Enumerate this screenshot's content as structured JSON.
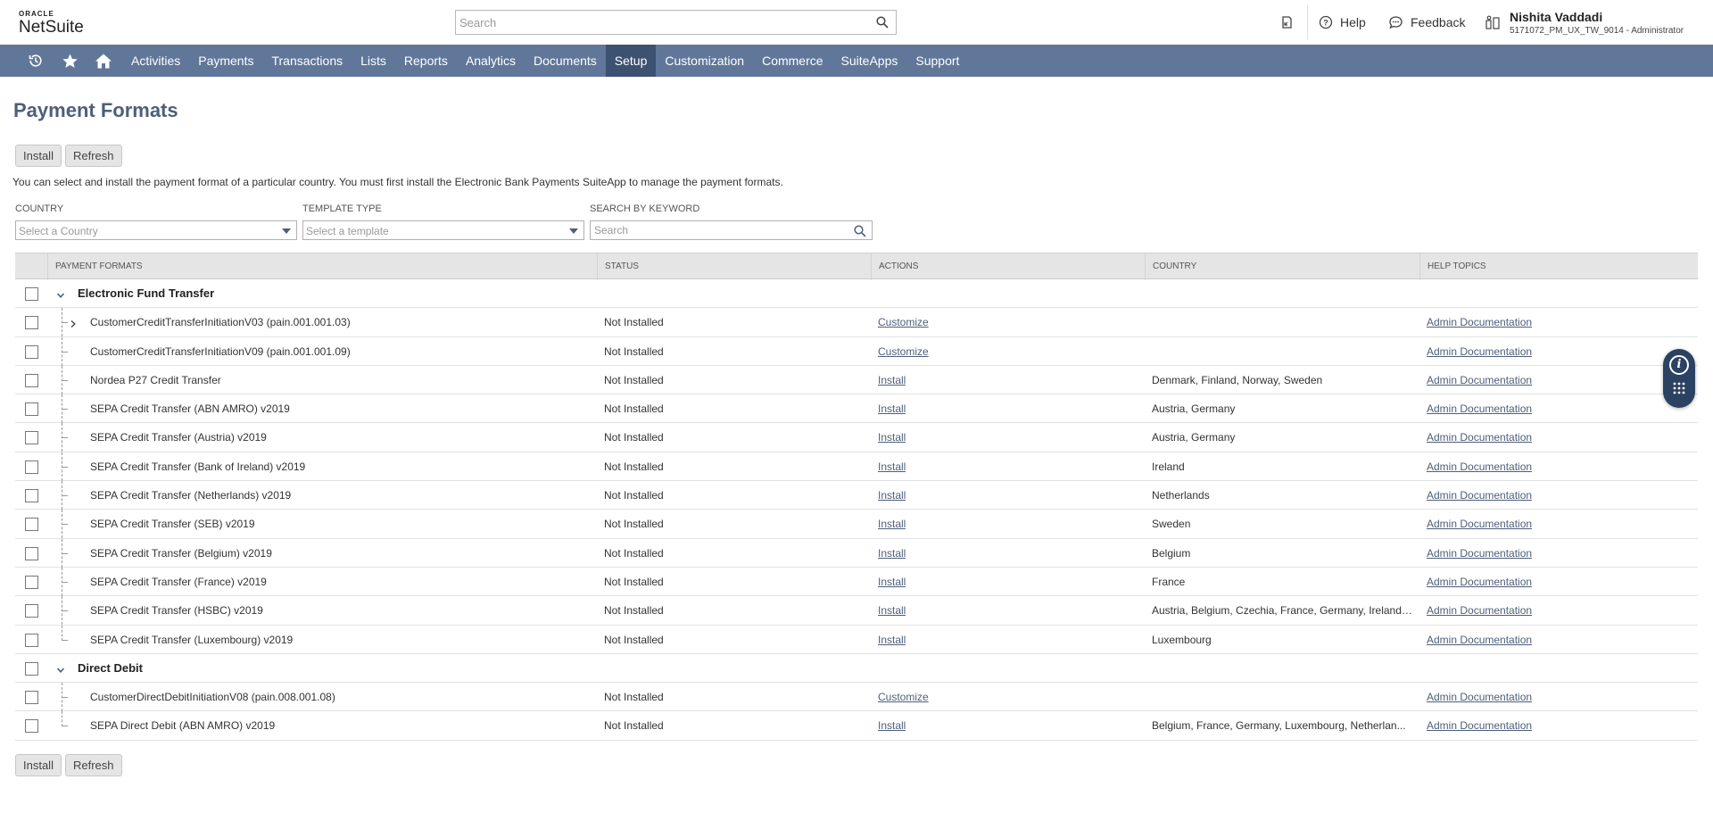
{
  "header": {
    "logo_top": "ORACLE",
    "logo_main": "NetSuite",
    "search_placeholder": "Search",
    "help_label": "Help",
    "feedback_label": "Feedback",
    "user_name": "Nishita Vaddadi",
    "user_role": "5171072_PM_UX_TW_9014 - Administrator"
  },
  "nav": {
    "items": [
      "Activities",
      "Payments",
      "Transactions",
      "Lists",
      "Reports",
      "Analytics",
      "Documents",
      "Setup",
      "Customization",
      "Commerce",
      "SuiteApps",
      "Support"
    ],
    "active": "Setup"
  },
  "page": {
    "title": "Payment Formats",
    "install_label": "Install",
    "refresh_label": "Refresh",
    "description": "You can select and install the payment format of a particular country. You must first install the Electronic Bank Payments SuiteApp to manage the payment formats."
  },
  "filters": {
    "country_label": "COUNTRY",
    "country_placeholder": "Select a Country",
    "template_label": "TEMPLATE TYPE",
    "template_placeholder": "Select a template",
    "keyword_label": "SEARCH BY KEYWORD",
    "keyword_placeholder": "Search"
  },
  "table": {
    "columns": [
      "PAYMENT FORMATS",
      "STATUS",
      "ACTIONS",
      "COUNTRY",
      "HELP TOPICS"
    ],
    "groups": [
      {
        "name": "Electronic Fund Transfer",
        "rows": [
          {
            "format": "CustomerCreditTransferInitiationV03 (pain.001.001.03)",
            "status": "Not Installed",
            "action": "Customize",
            "country": "",
            "help": "Admin Documentation",
            "expandable": true
          },
          {
            "format": "CustomerCreditTransferInitiationV09 (pain.001.001.09)",
            "status": "Not Installed",
            "action": "Customize",
            "country": "",
            "help": "Admin Documentation"
          },
          {
            "format": "Nordea P27 Credit Transfer",
            "status": "Not Installed",
            "action": "Install",
            "country": "Denmark, Finland, Norway, Sweden",
            "help": "Admin Documentation"
          },
          {
            "format": "SEPA Credit Transfer (ABN AMRO) v2019",
            "status": "Not Installed",
            "action": "Install",
            "country": "Austria, Germany",
            "help": "Admin Documentation"
          },
          {
            "format": "SEPA Credit Transfer (Austria) v2019",
            "status": "Not Installed",
            "action": "Install",
            "country": "Austria, Germany",
            "help": "Admin Documentation"
          },
          {
            "format": "SEPA Credit Transfer (Bank of Ireland) v2019",
            "status": "Not Installed",
            "action": "Install",
            "country": "Ireland",
            "help": "Admin Documentation"
          },
          {
            "format": "SEPA Credit Transfer (Netherlands) v2019",
            "status": "Not Installed",
            "action": "Install",
            "country": "Netherlands",
            "help": "Admin Documentation"
          },
          {
            "format": "SEPA Credit Transfer (SEB) v2019",
            "status": "Not Installed",
            "action": "Install",
            "country": "Sweden",
            "help": "Admin Documentation"
          },
          {
            "format": "SEPA Credit Transfer (Belgium) v2019",
            "status": "Not Installed",
            "action": "Install",
            "country": "Belgium",
            "help": "Admin Documentation"
          },
          {
            "format": "SEPA Credit Transfer (France) v2019",
            "status": "Not Installed",
            "action": "Install",
            "country": "France",
            "help": "Admin Documentation"
          },
          {
            "format": "SEPA Credit Transfer (HSBC) v2019",
            "status": "Not Installed",
            "action": "Install",
            "country": "Austria, Belgium, Czechia, France, Germany, Ireland,...",
            "help": "Admin Documentation"
          },
          {
            "format": "SEPA Credit Transfer (Luxembourg) v2019",
            "status": "Not Installed",
            "action": "Install",
            "country": "Luxembourg",
            "help": "Admin Documentation"
          }
        ]
      },
      {
        "name": "Direct Debit",
        "rows": [
          {
            "format": "CustomerDirectDebitInitiationV08 (pain.008.001.08)",
            "status": "Not Installed",
            "action": "Customize",
            "country": "",
            "help": "Admin Documentation"
          },
          {
            "format": "SEPA Direct Debit (ABN AMRO) v2019",
            "status": "Not Installed",
            "action": "Install",
            "country": "Belgium, France, Germany, Luxembourg, Netherlan...",
            "help": "Admin Documentation"
          }
        ]
      }
    ]
  },
  "icons": {
    "recent": "history-icon",
    "favorites": "star-icon",
    "home": "home-icon",
    "search": "search-icon",
    "info": "info-icon",
    "grid": "grid-icon"
  },
  "colors": {
    "nav_bg": "#607799",
    "nav_active": "#3d5170",
    "title": "#4d5f79",
    "link": "#4d5f79",
    "widget": "#2c4262"
  }
}
